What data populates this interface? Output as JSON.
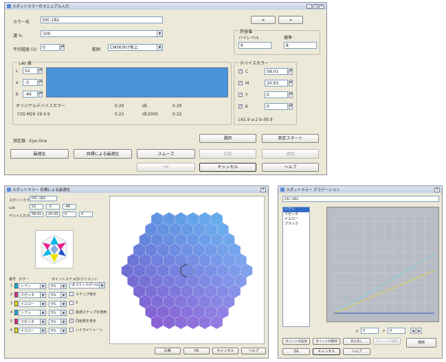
{
  "win1": {
    "title": "スポットカラーのマニュアル入力",
    "color_name_label": "カラー名",
    "color_name_value": "DIC-182",
    "nav_prev": "<",
    "nav_next": ">",
    "density_label": "濃 %",
    "density_value": "100",
    "avg_label": "平均階度 (S)",
    "avg_value": "0",
    "type_label": "範囲",
    "type_value": "CMYK分け色上",
    "tolerance": {
      "title": "許容値",
      "high_label": "ハイレベル",
      "std_label": "標準",
      "high_value": "6",
      "std_value": "8"
    },
    "lab": {
      "title": "Lab 値",
      "L_label": "L",
      "L_value": "52",
      "a_label": "a",
      "a_value": "-3",
      "b_label": "b",
      "b_value": "-46",
      "preview_color": "#4b93d8"
    },
    "device": {
      "title": "デバイスカラー",
      "rows": [
        {
          "name": "C",
          "value": "58.01"
        },
        {
          "name": "M",
          "value": "20.93"
        },
        {
          "name": "Y",
          "value": "0"
        },
        {
          "name": "K",
          "value": "0"
        }
      ],
      "lab_readout": "L61.9 a-2 b-39.9"
    },
    "original_device_label": "オリジナルデバイスカラー",
    "delta_rows": [
      {
        "label": "",
        "v1": "0.29",
        "dlabel": "dE",
        "v2": "0.29"
      },
      {
        "label": "CSS M26 19 4.9",
        "v1": "0.22",
        "dlabel": "dE2000",
        "v2": "0.22"
      }
    ],
    "instrument_label": "測定器 : Eye-One",
    "btn_select": "選択",
    "btn_measure_start": "測定スタート",
    "btn_optimize": "最適化",
    "btn_optimize_target": "目標による最適化",
    "btn_smooth": "スムーズ",
    "btn_disabled1": "比較",
    "btn_disabled2": "適用",
    "btn_ok": "OK",
    "btn_cancel": "キャンセル",
    "btn_help": "ヘルプ"
  },
  "win2": {
    "title": "スポットカラー 目標による最適化",
    "spot_label": "スポットカラー",
    "spot_value": "DIC-182",
    "lab_label": "Lab",
    "lab_vals": [
      "52",
      "-3",
      "-46"
    ],
    "device_label": "デバイスカラー",
    "device_vals": [
      "58.01",
      "20.93",
      "0",
      "0"
    ],
    "table_headers": [
      "番号",
      "カラー",
      "ポイントステップ",
      "インクリメント"
    ],
    "table_rows": [
      {
        "num": "1",
        "color": "シアン",
        "pct": "5%",
        "swatch": "#00b4e8"
      },
      {
        "num": "2",
        "color": "マゼンタ",
        "pct": "5%",
        "swatch": "#e8208a"
      },
      {
        "num": "3",
        "color": "イエロー",
        "pct": "5%",
        "swatch": "#f2e200"
      },
      {
        "num": "4",
        "color": "シアン",
        "pct": "5%",
        "swatch": "#00b4e8"
      },
      {
        "num": "5",
        "color": "マゼンタ",
        "pct": "5%",
        "swatch": "#e8208a"
      },
      {
        "num": "6",
        "color": "イエロー",
        "pct": "5%",
        "swatch": "#f2e200"
      }
    ],
    "increment_value": "dE 0.5 × 0.67 max",
    "options": [
      {
        "label": "ステップ表示",
        "checked": false
      },
      {
        "label": "5",
        "checked": false
      },
      {
        "label": "最適ステップを使用",
        "checked": false
      },
      {
        "label": "同色数を表示",
        "checked": true
      },
      {
        "label": "ハイライトトーン",
        "checked": false
      }
    ],
    "btn_compare": "比較",
    "btn_ok": "OK",
    "btn_cancel": "キャンセル",
    "btn_help": "ヘルプ"
  },
  "win3": {
    "title": "スポットカラー グラデーション",
    "color_name": "DIC-182",
    "list_items": [
      "シアン",
      "マゼンタ",
      "イエロー",
      "ブラック"
    ],
    "x_label": "X",
    "x_value": "0",
    "y_label": "Y",
    "y_value": "0",
    "btn_add": "ポイントの追加",
    "btn_delete": "ポイントの削除",
    "btn_reset": "元に戻し",
    "btn_disabled": "ポイントの選択",
    "btn_apply": "適用",
    "btn_ok": "OK",
    "btn_cancel": "キャンセル",
    "btn_help": "ヘルプ"
  },
  "colors": {
    "hex_fill": "#6a8fd8",
    "graph_bg": "#b8bcc4",
    "cyan_line": "#7fd2e6",
    "yellow_line": "#e6d84a"
  }
}
